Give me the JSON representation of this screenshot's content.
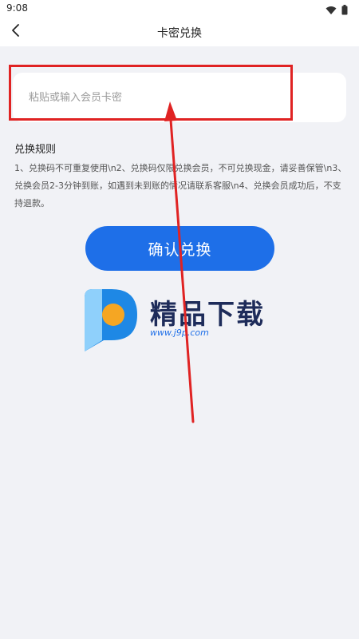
{
  "status_bar": {
    "time": "9:08",
    "icons": [
      "wifi-icon",
      "battery-icon"
    ]
  },
  "nav": {
    "back_icon": "chevron-left-icon",
    "title": "卡密兑换"
  },
  "form": {
    "placeholder": "粘贴或输入会员卡密",
    "value": ""
  },
  "rules": {
    "title": "兑换规则",
    "text": "1、兑换码不可重复使用\\n2、兑换码仅限兑换会员，不可兑换现金，请妥善保管\\n3、兑换会员2-3分钟到账，如遇到未到账的情况请联系客服\\n4、兑换会员成功后，不支持退款。"
  },
  "confirm_button": {
    "label": "确认兑换"
  },
  "watermark": {
    "brand": "精品下载",
    "url": "www.j9p.com"
  },
  "colors": {
    "accent": "#1e6fe8",
    "background": "#f1f2f6",
    "annotation": "#e02323"
  }
}
